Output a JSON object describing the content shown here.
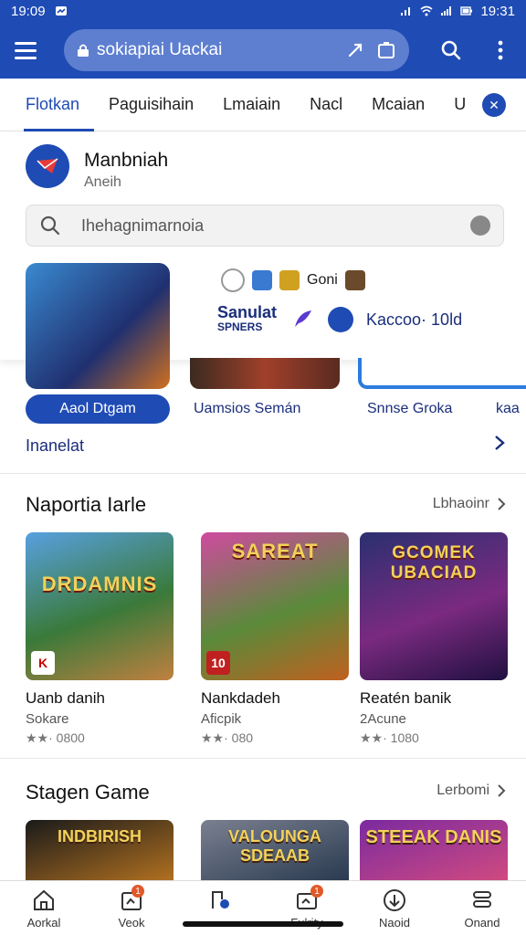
{
  "status_bar": {
    "time_left": "19:09",
    "time_right": "19:31"
  },
  "browser": {
    "url": "sokiapiai Uackai"
  },
  "tabs": [
    {
      "label": "Flotkan",
      "active": true
    },
    {
      "label": "Paguisihain",
      "active": false
    },
    {
      "label": "Lmaiain",
      "active": false
    },
    {
      "label": "Nacl",
      "active": false
    },
    {
      "label": "Mcaian",
      "active": false
    },
    {
      "label": "U",
      "active": false
    }
  ],
  "app": {
    "name": "Manbniah",
    "subtitle": "Aneih"
  },
  "search": {
    "placeholder": "Ihehagnimarnoia"
  },
  "quickrow": {
    "right_label": "Goni"
  },
  "promo": {
    "brand_top": "Sanulat",
    "brand_bottom": "SPNERS",
    "right": "Kaccoo· 10ld"
  },
  "featured": {
    "button_label": "Aaol Dtgam",
    "labels": [
      "Uamsios Semán",
      "Snnse Groka",
      "kaa"
    ],
    "more_label": "Inanelat"
  },
  "section1": {
    "title": "Naportia Iarle",
    "more": "Lbhaoinr",
    "cards": [
      {
        "art_title": "DRDAMNIS",
        "corner": "K",
        "name": "Uanb danih",
        "category": "Sokare",
        "rating": "★★· 0800"
      },
      {
        "art_title": "SAREAT",
        "corner": "10",
        "name": "Nankdadeh",
        "category": "Aficpik",
        "rating": "★★· 080"
      },
      {
        "art_title": "GCOMEK UBACIAD",
        "corner": "",
        "name": "Reatén banik",
        "category": "2Acune",
        "rating": "★★· 1080"
      }
    ]
  },
  "section2": {
    "title": "Stagen Game",
    "more": "Lerbomi",
    "cards": [
      {
        "art_title": "INDBIRISH"
      },
      {
        "art_title": "VALOUNGA SDEAAB"
      },
      {
        "art_title": "STEEAK DANIS"
      }
    ]
  },
  "bottom_nav": [
    {
      "label": "Aorkal",
      "badge": ""
    },
    {
      "label": "Veok",
      "badge": "1"
    },
    {
      "label": "",
      "badge": ""
    },
    {
      "label": "Fulrity",
      "badge": "1"
    },
    {
      "label": "Naoid",
      "badge": ""
    },
    {
      "label": "Onand",
      "badge": ""
    }
  ],
  "colors": {
    "brand": "#1f4bb4",
    "accent_orange": "#e0592a"
  }
}
